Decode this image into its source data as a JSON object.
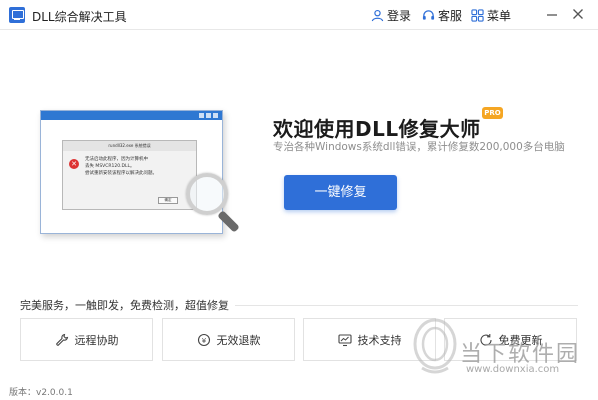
{
  "window": {
    "title": "DLL综合解决工具",
    "login_label": "登录",
    "service_label": "客服",
    "menu_label": "菜单",
    "icons": {
      "login": "user-icon",
      "service": "headset-icon",
      "menu": "grid-icon",
      "minimize": "minimize-icon",
      "close": "close-icon"
    }
  },
  "illustration": {
    "dialog_title": "rundll32.exe  系统错误",
    "dialog_lines": [
      "无法启动此程序，因为计算机中",
      "丢失 MSVCR120.DLL。",
      "尝试重新安装该程序以解决此问题。"
    ],
    "dialog_button": "确定"
  },
  "hero": {
    "headline": "欢迎使用DLL修复大师",
    "badge": "PRO",
    "subline": "专治各种Windows系统dll错误，累计修复数200,000多台电脑",
    "fix_button_label": "一键修复"
  },
  "services": {
    "caption": "完美服务，一触即发，免费检测，超值修复",
    "items": [
      {
        "label": "远程协助",
        "icon": "wrench-icon"
      },
      {
        "label": "无效退款",
        "icon": "refund-icon"
      },
      {
        "label": "技术支持",
        "icon": "monitor-chart-icon"
      },
      {
        "label": "免费更新",
        "icon": "refresh-icon"
      }
    ]
  },
  "footer": {
    "version": "版本：v2.0.0.1"
  },
  "watermark": {
    "name": "当下软件园",
    "url": "www.downxia.com"
  },
  "colors": {
    "accent": "#2f6fd8",
    "badge": "#f5a623",
    "titlebar_icon": "#2f6fd8"
  }
}
